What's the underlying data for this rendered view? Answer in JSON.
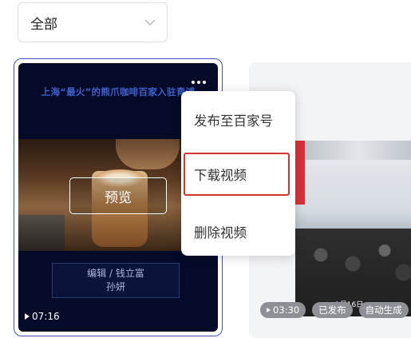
{
  "filter": {
    "selected": "全部",
    "icon": "chevron-down-icon"
  },
  "card1": {
    "banner": "上海“最火”的熊爪咖啡百家入驻青浦",
    "preview_label": "预览",
    "credit_line1": "编辑 / 钱立富",
    "credit_line2": "孙妍",
    "duration": "07:16",
    "more_icon": "more-horizontal-icon"
  },
  "card2": {
    "photo_date": "3月16日",
    "tags": [
      {
        "label": "03:30",
        "icon": "play-icon"
      },
      {
        "label": "已发布"
      },
      {
        "label": "自动生成"
      }
    ]
  },
  "menu": {
    "items": [
      {
        "label": "发布至百家号"
      },
      {
        "label": "下载视频",
        "highlighted": true
      },
      {
        "label": "删除视频"
      }
    ]
  },
  "colors": {
    "accent": "#3b54c2",
    "highlight": "#d6342d",
    "tag_bg": "#8e9096"
  }
}
